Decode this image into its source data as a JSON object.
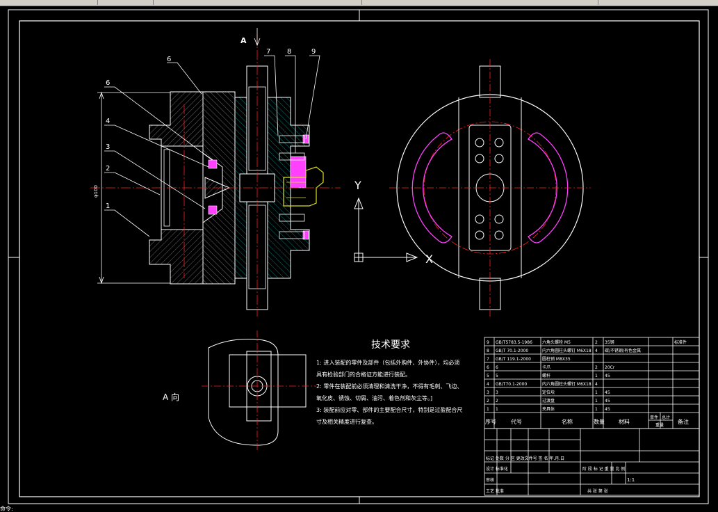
{
  "view_label": "A",
  "view_label_section": "A  向",
  "axis": {
    "y": "Y",
    "x": "X"
  },
  "diameter_dim": "φ100",
  "callouts": [
    "6",
    "6",
    "4",
    "3",
    "2",
    "1",
    "7",
    "8",
    "9"
  ],
  "tech": {
    "title": "技术要求",
    "lines": [
      "1: 进入装配的零件及部件（包括外购件、外协件），均必须",
      "具有检验部门的合格证方能进行装配。",
      "2: 零件在装配前必须清理和清洗干净，不得有毛刺、飞边、",
      "氧化皮、锈蚀、切屑、油污、着色剂和灰尘等。]",
      "3: 装配前应对零、部件的主要配合尺寸，特别是过盈配合尺",
      "寸及相关精度进行复查。"
    ]
  },
  "bom": {
    "rows": [
      [
        "9",
        "GB/T5783.5-1986",
        "六角头螺栓 M5",
        "2",
        "35钢",
        "",
        "",
        "标准件"
      ],
      [
        "8",
        "GB/T 70.1-2000",
        "内六角圆柱头螺钉 M6X18",
        "4",
        "碳/不锈钢/有色金属",
        "",
        "",
        ""
      ],
      [
        "7",
        "GB/T 119.1-2000",
        "圆柱销 M8X35",
        "",
        "",
        "",
        "",
        ""
      ],
      [
        "6",
        "6",
        "卡爪",
        "2",
        "20Cr",
        "",
        "",
        ""
      ],
      [
        "5",
        "5",
        "螺杆",
        "1",
        "45",
        "",
        "",
        ""
      ],
      [
        "4",
        "GB/T70.1-2000",
        "内六角圆柱头螺钉 M6X18",
        "4",
        "",
        "",
        "",
        ""
      ],
      [
        "3",
        "3",
        "定位块",
        "1",
        "45",
        "",
        "",
        ""
      ],
      [
        "2",
        "2",
        "过渡盘",
        "1",
        "45",
        "",
        "",
        ""
      ],
      [
        "1",
        "1",
        "夹具体",
        "1",
        "45",
        "",
        "",
        ""
      ]
    ],
    "header": [
      "序号",
      "代号",
      "名称",
      "数量",
      "材料",
      "单件",
      "总计",
      "备注"
    ],
    "header_sub": "重量"
  },
  "title_block": {
    "row1": "标记  处数  分 区  更改文件号  签 名  年.月.日",
    "row2": "设计      标准化",
    "row3": "审核",
    "row4": "工艺          批准",
    "stage": "阶 段 标 记   重 量   比 例",
    "scale": "1:1",
    "sheet": "共    张    第    张"
  },
  "cmdline": "命令: "
}
